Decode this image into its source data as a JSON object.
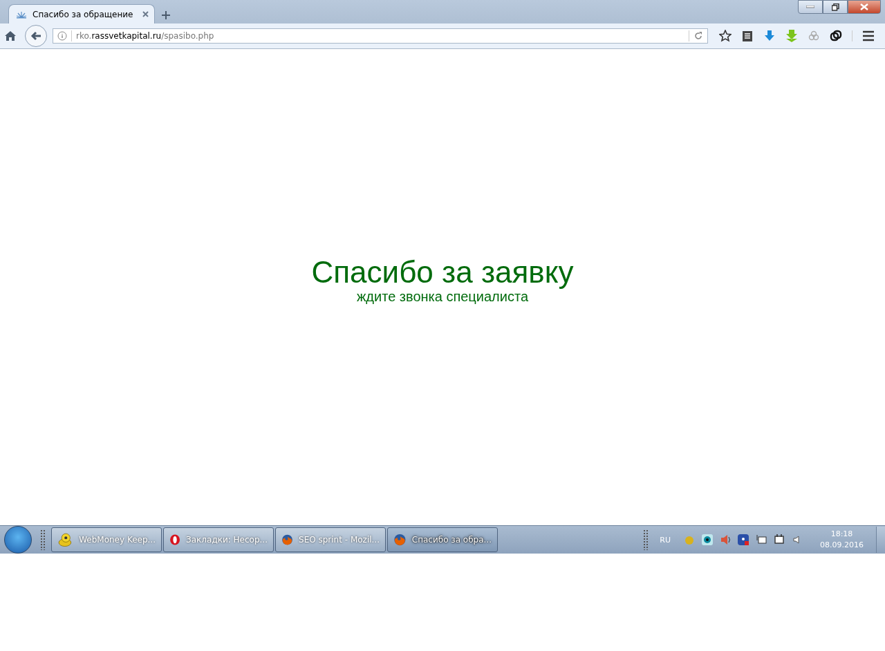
{
  "browser": {
    "tabs": [
      {
        "title": "Спасибо за обращение",
        "selected": true
      }
    ],
    "address": {
      "subdomain": "rko.",
      "domain": "rassvetkapital.ru",
      "path": "/spasibo.php"
    }
  },
  "page": {
    "heading": "Спасибо за заявку",
    "subheading": "ждите звонка специалиста"
  },
  "taskbar": {
    "items": [
      {
        "kind": "webmoney",
        "label": "WebMoney Keep...",
        "selected": false
      },
      {
        "kind": "opera",
        "label": "Закладки: Несор...",
        "selected": false
      },
      {
        "kind": "firefox",
        "label": "SEO sprint - Mozil...",
        "selected": false
      },
      {
        "kind": "firefox",
        "label": "Спасибо за обра...",
        "selected": true
      }
    ],
    "language": "RU",
    "time": "18:18",
    "date": "08.09.2016"
  }
}
